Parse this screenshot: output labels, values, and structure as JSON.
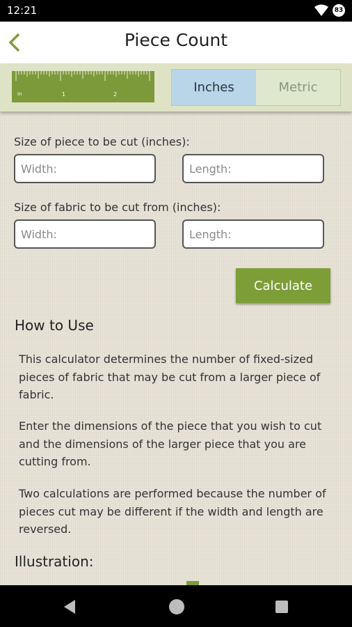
{
  "status_bar": {
    "time": "12:21",
    "icons": [
      "wifi-icon",
      "battery-icon"
    ],
    "battery_label": "83"
  },
  "app_bar": {
    "title": "Piece Count",
    "back_icon": "chevron-left-icon"
  },
  "unit_bar": {
    "ruler_labels": [
      "in",
      "1",
      "2"
    ],
    "options": [
      {
        "label": "Inches",
        "selected": true
      },
      {
        "label": "Metric",
        "selected": false
      }
    ]
  },
  "form": {
    "piece_label": "Size of piece to be cut (inches):",
    "piece_width_placeholder": "Width:",
    "piece_length_placeholder": "Length:",
    "fabric_label": "Size of fabric to be cut from (inches):",
    "fabric_width_placeholder": "Width:",
    "fabric_length_placeholder": "Length:",
    "calculate_label": "Calculate"
  },
  "how_to_use": {
    "heading": "How to Use",
    "paragraphs": [
      "This calculator determines the number of fixed-sized pieces of fabric that may be cut from a larger piece of fabric.",
      "Enter the dimensions of the piece that you wish to cut and the dimensions of the larger piece that you are cutting from.",
      "Two calculations are performed because the number of pieces cut may be different if the width and length are reversed."
    ]
  },
  "illustration": {
    "heading": "Illustration:"
  },
  "colors": {
    "accent_green": "#7d9d37",
    "selected_blue": "#b8d6e8",
    "header_bg": "#dfe3c6"
  },
  "nav_bar": {
    "icons": [
      "back-triangle-icon",
      "home-circle-icon",
      "recents-square-icon"
    ]
  }
}
